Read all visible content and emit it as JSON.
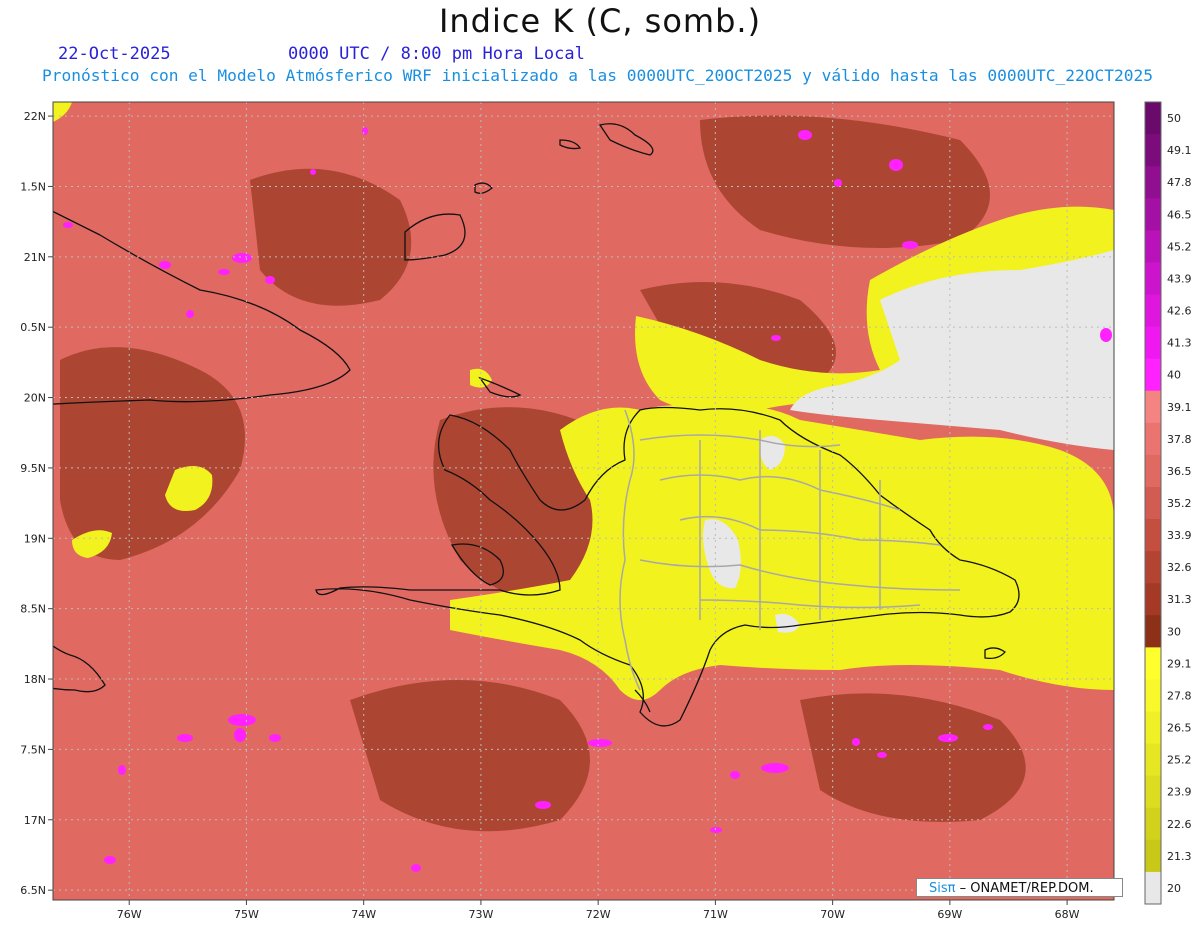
{
  "header": {
    "title": "Indice K (C, somb.)",
    "date": "22-Oct-2025",
    "time": "0000 UTC / 8:00 pm Hora Local",
    "subtitle": "Pronóstico con el Modelo Atmósferico WRF inicializado a las 0000UTC_20OCT2025 y válido hasta las  0000UTC_22OCT2025"
  },
  "credit": {
    "brand": "Sisπ",
    "text": " – ONAMET/REP.DOM."
  },
  "map": {
    "lat_labels": [
      "22N",
      "1.5N",
      "21N",
      "0.5N",
      "20N",
      "9.5N",
      "19N",
      "8.5N",
      "18N",
      "7.5N",
      "17N",
      "6.5N"
    ],
    "lat_values": [
      22,
      21.5,
      21,
      20.5,
      20,
      19.5,
      19,
      18.5,
      18,
      17.5,
      17,
      16.5
    ],
    "lon_labels": [
      "76W",
      "75W",
      "74W",
      "73W",
      "72W",
      "71W",
      "70W",
      "69W",
      "68W"
    ],
    "lon_values": [
      -76,
      -75,
      -74,
      -73,
      -72,
      -71,
      -70,
      -69,
      -68
    ],
    "extent": {
      "lon_min": -76.65,
      "lon_max": -67.6,
      "lat_min": 16.43,
      "lat_max": 22.1
    },
    "colors": {
      "base": "#e06a62",
      "dark": "#a6432e",
      "yellow": "#f2f21e",
      "lightyellow": "#e6e63a",
      "none": "#e8e8e8",
      "magenta": "#ff22ff",
      "coast": "#111111",
      "border": "#a8a8a8"
    }
  },
  "legend": {
    "labels": [
      "50",
      "49.1",
      "47.8",
      "46.5",
      "45.2",
      "43.9",
      "42.6",
      "41.3",
      "40",
      "39.1",
      "37.8",
      "36.5",
      "35.2",
      "33.9",
      "32.6",
      "31.3",
      "30",
      "29.1",
      "27.8",
      "26.5",
      "25.2",
      "23.9",
      "22.6",
      "21.3",
      "20"
    ],
    "colors": [
      "#6a0a6a",
      "#7c0c7c",
      "#900e90",
      "#a410a4",
      "#b812b8",
      "#cc14cc",
      "#de16de",
      "#f018f0",
      "#ff22ff",
      "#f48482",
      "#ec7470",
      "#e06a62",
      "#d25c52",
      "#c44e40",
      "#b44432",
      "#a43a26",
      "#8c3018",
      "#ffff2e",
      "#f8f82a",
      "#f0f026",
      "#e6e622",
      "#dcdc20",
      "#d2d21c",
      "#c8c818",
      "#e8e8e8"
    ]
  }
}
